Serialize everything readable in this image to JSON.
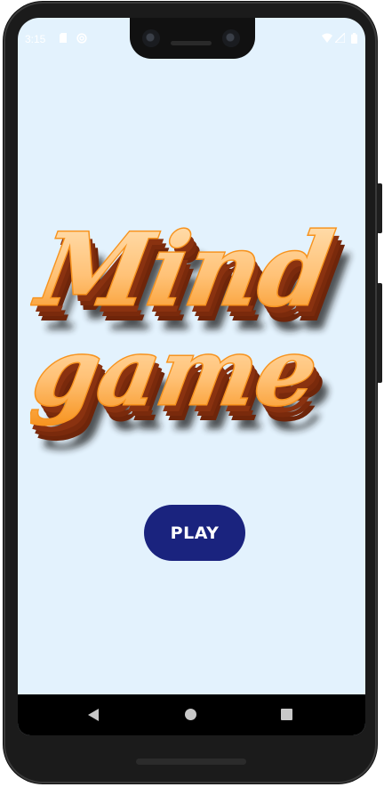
{
  "status_bar": {
    "time": "3:15",
    "icons": [
      "sd-card-icon",
      "at-sign-icon",
      "wifi-icon",
      "signal-icon",
      "battery-icon"
    ]
  },
  "logo": {
    "line1": "Mind",
    "line2": "game",
    "colors": {
      "fill_light": "#ffd59e",
      "fill_dark": "#f7931e",
      "extrude": "#7a2a0c",
      "shadow": "#1b1b1b"
    }
  },
  "play_button": {
    "label": "PLAY",
    "color": "#1a237e"
  },
  "nav_bar": {
    "icons": [
      "back-icon",
      "home-icon",
      "recents-icon"
    ]
  },
  "theme": {
    "background": "#e3f2fd"
  }
}
